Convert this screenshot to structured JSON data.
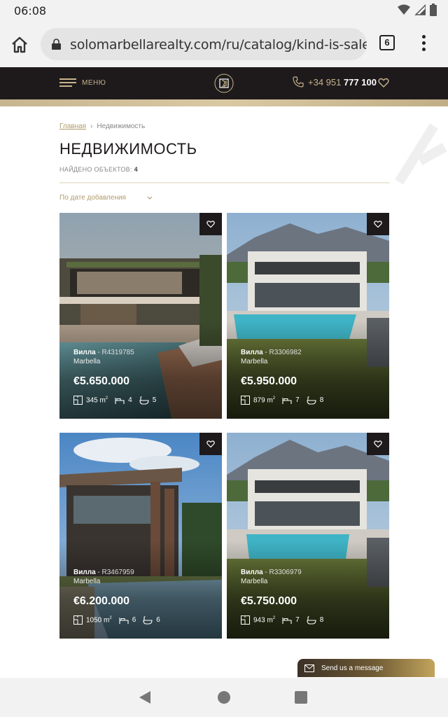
{
  "status": {
    "time": "06:08"
  },
  "browser": {
    "url": "solomarbellarealty.com/ru/catalog/kind-is-sale/p",
    "tab_count": "6"
  },
  "header": {
    "menu_label": "МЕНЮ",
    "phone_prefix": "+34 951",
    "phone_number": "777 100"
  },
  "breadcrumb": {
    "home": "Главная",
    "separator": "›",
    "current": "Недвижимость"
  },
  "page": {
    "title": "НЕДВИЖИМОСТЬ",
    "found_label": "НАЙДЕНО ОБЪЕКТОВ:",
    "found_count": "4",
    "sort_label": "По дате добавления"
  },
  "listings": [
    {
      "type": "Вилла",
      "ref": " - R4319785",
      "location": "Marbella",
      "price": "€5.650.000",
      "area": "345 m",
      "beds": "4",
      "baths": "5"
    },
    {
      "type": "Вилла",
      "ref": " - R3306982",
      "location": "Marbella",
      "price": "€5.950.000",
      "area": "879 m",
      "beds": "7",
      "baths": "8"
    },
    {
      "type": "Вилла",
      "ref": " - R3467959",
      "location": "Marbella",
      "price": "€6.200.000",
      "area": "1050 m",
      "beds": "6",
      "baths": "6"
    },
    {
      "type": "Вилла",
      "ref": " - R3306979",
      "location": "Marbella",
      "price": "€5.750.000",
      "area": "943 m",
      "beds": "7",
      "baths": "8"
    }
  ],
  "area_unit_sup": "2",
  "chat": {
    "label": "Send us a message"
  },
  "colors": {
    "brand_dark": "#1e1a1c",
    "gold": "#c8b48c",
    "gold_link": "#b09a6a"
  }
}
